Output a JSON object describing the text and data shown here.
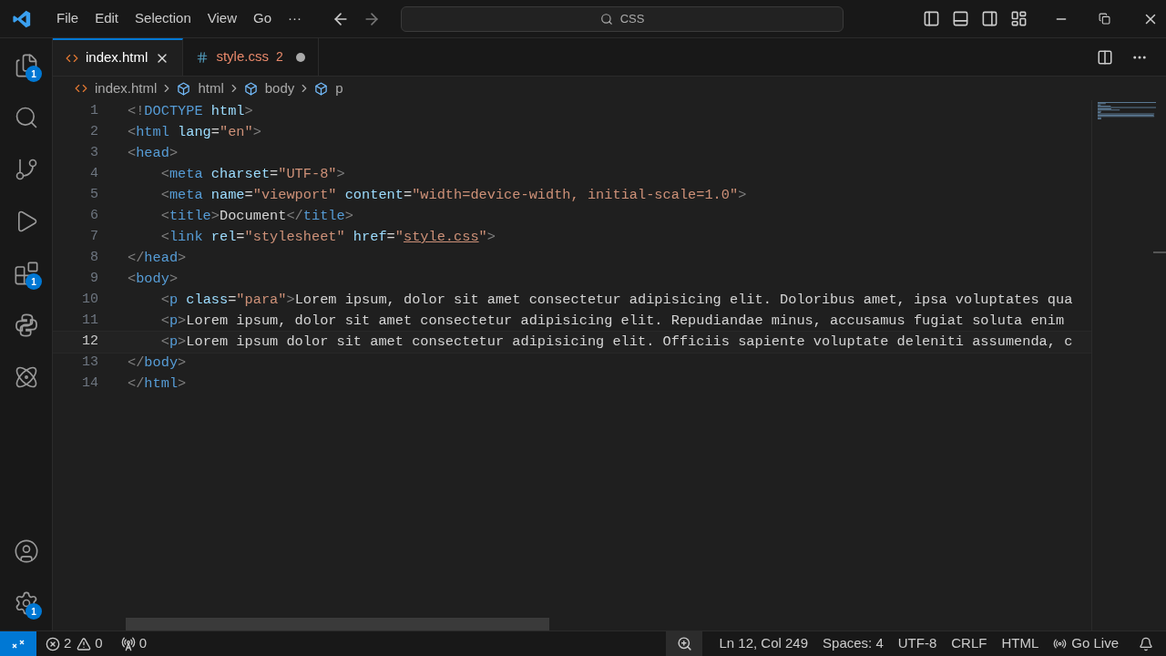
{
  "menu": [
    "File",
    "Edit",
    "Selection",
    "View",
    "Go",
    "···"
  ],
  "search": {
    "value": "CSS"
  },
  "activity": [
    {
      "kind": "files",
      "badge": "1"
    },
    {
      "kind": "search"
    },
    {
      "kind": "source-control"
    },
    {
      "kind": "debug"
    },
    {
      "kind": "extensions",
      "badge": "1"
    },
    {
      "kind": "python"
    },
    {
      "kind": "react"
    }
  ],
  "activity_bottom": [
    {
      "kind": "account"
    },
    {
      "kind": "settings",
      "badge": "1"
    }
  ],
  "tabs": [
    {
      "kind": "html",
      "label": "index.html",
      "selected": true,
      "modified": false
    },
    {
      "kind": "css",
      "label": "style.css",
      "selected": false,
      "modified": true,
      "problems": "2"
    }
  ],
  "breadcrumb": [
    {
      "kind": "file",
      "label": "index.html"
    },
    {
      "kind": "symbol",
      "label": "html"
    },
    {
      "kind": "symbol",
      "label": "body"
    },
    {
      "kind": "symbol",
      "label": "p"
    }
  ],
  "lines": [
    {
      "number": "1",
      "current": false,
      "tokens": [
        {
          "kind": "punct",
          "text": "<!"
        },
        {
          "kind": "tag",
          "text": "DOCTYPE"
        },
        {
          "kind": "attr",
          "text": " html"
        },
        {
          "kind": "punct",
          "text": ">"
        }
      ]
    },
    {
      "number": "2",
      "current": false,
      "tokens": [
        {
          "kind": "punct",
          "text": "<"
        },
        {
          "kind": "tag",
          "text": "html"
        },
        {
          "kind": "attr",
          "text": " lang"
        },
        {
          "kind": "text",
          "text": "="
        },
        {
          "kind": "string",
          "text": "\"en\""
        },
        {
          "kind": "punct",
          "text": ">"
        }
      ]
    },
    {
      "number": "3",
      "current": false,
      "tokens": [
        {
          "kind": "punct",
          "text": "<"
        },
        {
          "kind": "tag",
          "text": "head"
        },
        {
          "kind": "punct",
          "text": ">"
        }
      ]
    },
    {
      "number": "4",
      "current": false,
      "tokens": [
        {
          "kind": "punct",
          "text": "    <"
        },
        {
          "kind": "tag",
          "text": "meta"
        },
        {
          "kind": "attr",
          "text": " charset"
        },
        {
          "kind": "text",
          "text": "="
        },
        {
          "kind": "string",
          "text": "\"UTF-8\""
        },
        {
          "kind": "punct",
          "text": ">"
        }
      ]
    },
    {
      "number": "5",
      "current": false,
      "tokens": [
        {
          "kind": "punct",
          "text": "    <"
        },
        {
          "kind": "tag",
          "text": "meta"
        },
        {
          "kind": "attr",
          "text": " name"
        },
        {
          "kind": "text",
          "text": "="
        },
        {
          "kind": "string",
          "text": "\"viewport\""
        },
        {
          "kind": "attr",
          "text": " content"
        },
        {
          "kind": "text",
          "text": "="
        },
        {
          "kind": "string",
          "text": "\"width=device-width, initial-scale=1.0\""
        },
        {
          "kind": "punct",
          "text": ">"
        }
      ]
    },
    {
      "number": "6",
      "current": false,
      "tokens": [
        {
          "kind": "punct",
          "text": "    <"
        },
        {
          "kind": "tag",
          "text": "title"
        },
        {
          "kind": "punct",
          "text": ">"
        },
        {
          "kind": "text",
          "text": "Document"
        },
        {
          "kind": "punct",
          "text": "</"
        },
        {
          "kind": "tag",
          "text": "title"
        },
        {
          "kind": "punct",
          "text": ">"
        }
      ]
    },
    {
      "number": "7",
      "current": false,
      "tokens": [
        {
          "kind": "punct",
          "text": "    <"
        },
        {
          "kind": "tag",
          "text": "link"
        },
        {
          "kind": "attr",
          "text": " rel"
        },
        {
          "kind": "text",
          "text": "="
        },
        {
          "kind": "string",
          "text": "\"stylesheet\""
        },
        {
          "kind": "attr",
          "text": " href"
        },
        {
          "kind": "text",
          "text": "="
        },
        {
          "kind": "string",
          "text": "\""
        },
        {
          "kind": "link",
          "text": "style.css"
        },
        {
          "kind": "string",
          "text": "\""
        },
        {
          "kind": "punct",
          "text": ">"
        }
      ]
    },
    {
      "number": "8",
      "current": false,
      "tokens": [
        {
          "kind": "punct",
          "text": "</"
        },
        {
          "kind": "tag",
          "text": "head"
        },
        {
          "kind": "punct",
          "text": ">"
        }
      ]
    },
    {
      "number": "9",
      "current": false,
      "tokens": [
        {
          "kind": "punct",
          "text": "<"
        },
        {
          "kind": "tag",
          "text": "body"
        },
        {
          "kind": "punct",
          "text": ">"
        }
      ]
    },
    {
      "number": "10",
      "current": false,
      "tokens": [
        {
          "kind": "punct",
          "text": "    <"
        },
        {
          "kind": "tag",
          "text": "p"
        },
        {
          "kind": "attr",
          "text": " class"
        },
        {
          "kind": "text",
          "text": "="
        },
        {
          "kind": "string",
          "text": "\"para\""
        },
        {
          "kind": "punct",
          "text": ">"
        },
        {
          "kind": "text",
          "text": "Lorem ipsum, dolor sit amet consectetur adipisicing elit. Doloribus amet, ipsa voluptates qua"
        }
      ]
    },
    {
      "number": "11",
      "current": false,
      "tokens": [
        {
          "kind": "punct",
          "text": "    <"
        },
        {
          "kind": "tag",
          "text": "p"
        },
        {
          "kind": "punct",
          "text": ">"
        },
        {
          "kind": "text",
          "text": "Lorem ipsum, dolor sit amet consectetur adipisicing elit. Repudiandae minus, accusamus fugiat soluta enim"
        }
      ]
    },
    {
      "number": "12",
      "current": true,
      "tokens": [
        {
          "kind": "punct",
          "text": "    <"
        },
        {
          "kind": "tag",
          "text": "p"
        },
        {
          "kind": "punct",
          "text": ">"
        },
        {
          "kind": "text",
          "text": "Lorem ipsum dolor sit amet consectetur adipisicing elit. Officiis sapiente voluptate deleniti assumenda, c"
        }
      ]
    },
    {
      "number": "13",
      "current": false,
      "tokens": [
        {
          "kind": "punct",
          "text": "</"
        },
        {
          "kind": "tag",
          "text": "body"
        },
        {
          "kind": "punct",
          "text": ">"
        }
      ]
    },
    {
      "number": "14",
      "current": false,
      "tokens": [
        {
          "kind": "punct",
          "text": "</"
        },
        {
          "kind": "tag",
          "text": "html"
        },
        {
          "kind": "punct",
          "text": ">"
        }
      ]
    }
  ],
  "status_left": [
    {
      "kind": "errors",
      "label": "2"
    },
    {
      "kind": "warnings",
      "label": "0"
    },
    {
      "kind": "ports",
      "label": "0"
    }
  ],
  "status_right": [
    {
      "kind": "zoom"
    },
    {
      "kind": "text",
      "label": "Ln 12, Col 249"
    },
    {
      "kind": "text",
      "label": "Spaces: 4"
    },
    {
      "kind": "text",
      "label": "UTF-8"
    },
    {
      "kind": "text",
      "label": "CRLF"
    },
    {
      "kind": "text",
      "label": "HTML"
    },
    {
      "kind": "live",
      "label": "Go Live"
    },
    {
      "kind": "bell"
    }
  ]
}
